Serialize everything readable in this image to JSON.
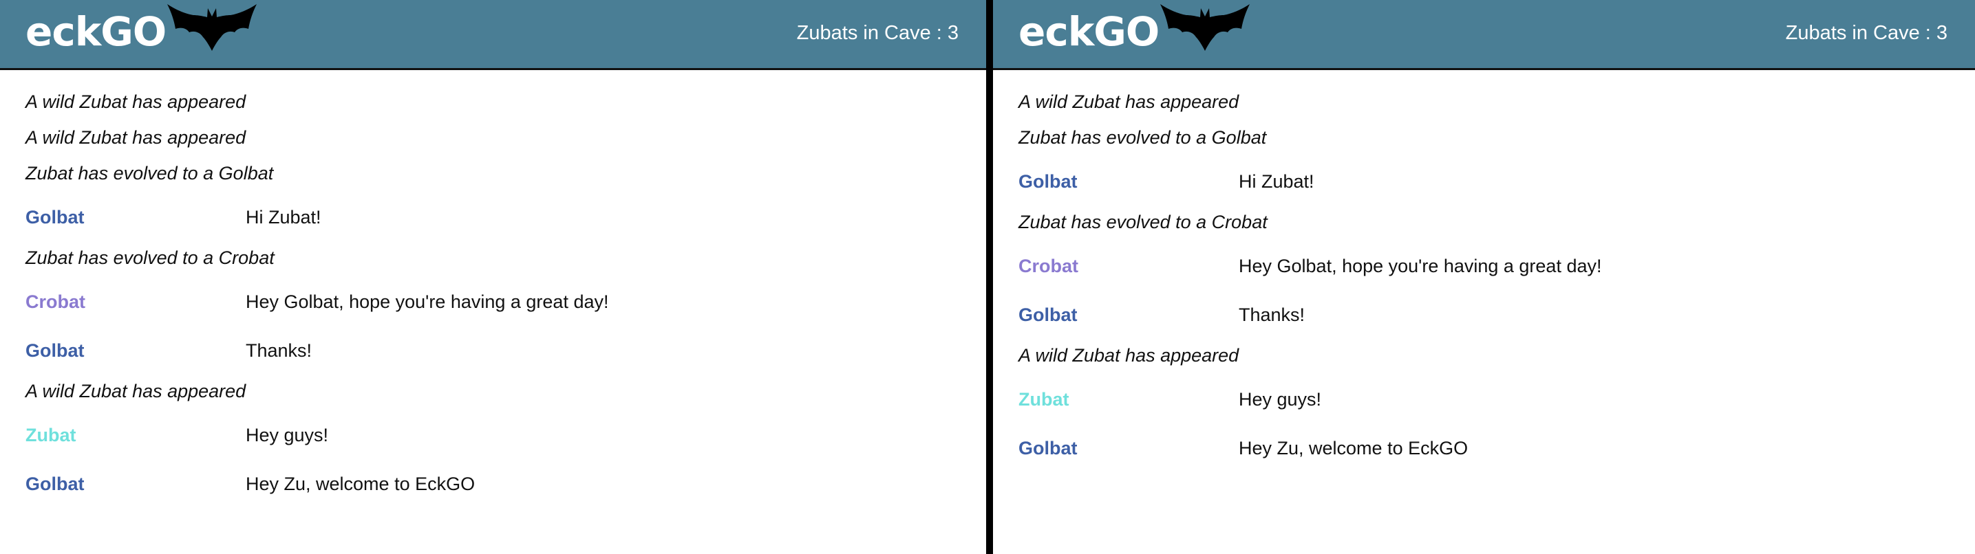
{
  "app": {
    "logo_text": "eckGO",
    "cave_label": "Zubats in Cave : 3"
  },
  "panes": [
    {
      "messages": [
        {
          "kind": "event",
          "text": "A wild Zubat has appeared"
        },
        {
          "kind": "event",
          "text": "A wild Zubat has appeared"
        },
        {
          "kind": "event",
          "text": "Zubat has evolved to a Golbat"
        },
        {
          "kind": "chat",
          "user": "Golbat",
          "user_color": "#3d5fa6",
          "text": "Hi Zubat!"
        },
        {
          "kind": "event",
          "text": "Zubat has evolved to a Crobat"
        },
        {
          "kind": "chat",
          "user": "Crobat",
          "user_color": "#8a7ad0",
          "text": "Hey Golbat, hope you're having a great day!"
        },
        {
          "kind": "chat",
          "user": "Golbat",
          "user_color": "#3d5fa6",
          "text": "Thanks!"
        },
        {
          "kind": "event",
          "text": "A wild Zubat has appeared"
        },
        {
          "kind": "chat",
          "user": "Zubat",
          "user_color": "#6fe0dc",
          "text": "Hey guys!"
        },
        {
          "kind": "chat",
          "user": "Golbat",
          "user_color": "#3d5fa6",
          "text": "Hey Zu, welcome to EckGO"
        }
      ]
    },
    {
      "messages": [
        {
          "kind": "event",
          "text": "A wild Zubat has appeared"
        },
        {
          "kind": "event",
          "text": "Zubat has evolved to a Golbat"
        },
        {
          "kind": "chat",
          "user": "Golbat",
          "user_color": "#3d5fa6",
          "text": "Hi Zubat!"
        },
        {
          "kind": "event",
          "text": "Zubat has evolved to a Crobat"
        },
        {
          "kind": "chat",
          "user": "Crobat",
          "user_color": "#8a7ad0",
          "text": "Hey Golbat, hope you're having a great day!"
        },
        {
          "kind": "chat",
          "user": "Golbat",
          "user_color": "#3d5fa6",
          "text": "Thanks!"
        },
        {
          "kind": "event",
          "text": "A wild Zubat has appeared"
        },
        {
          "kind": "chat",
          "user": "Zubat",
          "user_color": "#6fe0dc",
          "text": "Hey guys!"
        },
        {
          "kind": "chat",
          "user": "Golbat",
          "user_color": "#3d5fa6",
          "text": "Hey Zu, welcome to EckGO"
        }
      ]
    }
  ],
  "colors": {
    "header_bg": "#4a7e95",
    "golbat": "#3d5fa6",
    "crobat": "#8a7ad0",
    "zubat": "#6fe0dc"
  },
  "icons": {
    "logo_mark": "bat-icon"
  }
}
